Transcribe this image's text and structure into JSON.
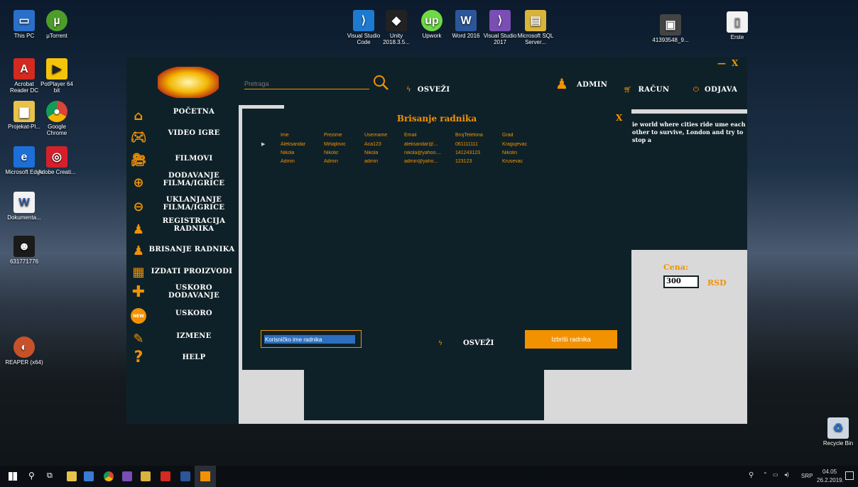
{
  "desktop": {
    "icons": [
      {
        "label": "This PC"
      },
      {
        "label": "µTorrent"
      },
      {
        "label": "Acrobat Reader DC"
      },
      {
        "label": "PotPlayer 64 bit"
      },
      {
        "label": "Projekat-Pl..."
      },
      {
        "label": "Google Chrome"
      },
      {
        "label": "Microsoft Edge"
      },
      {
        "label": "Adobe Creati..."
      },
      {
        "label": "Dokumenta..."
      },
      {
        "label": "631771776"
      },
      {
        "label": "REAPER (x64)"
      },
      {
        "label": "Visual Studio Code"
      },
      {
        "label": "Unity 2018.3.5..."
      },
      {
        "label": "Upwork"
      },
      {
        "label": "Word 2016"
      },
      {
        "label": "Visual Studio 2017"
      },
      {
        "label": "Microsoft SQL Server..."
      },
      {
        "label": "41393548_9..."
      },
      {
        "label": "Erste"
      },
      {
        "label": "Recycle Bin"
      }
    ]
  },
  "app": {
    "header": {
      "search_placeholder": "Pretraga",
      "refresh_label": "OSVEŽI",
      "admin_label": "ADMIN",
      "account_label": "RAČUN",
      "logout_label": "ODJAVA",
      "minimize_label": "—",
      "close_label": "X"
    },
    "sidebar": {
      "items": [
        {
          "label": "POČETNA"
        },
        {
          "label": "VIDEO IGRE"
        },
        {
          "label": "FILMOVI"
        },
        {
          "label": "DODAVANJE FILMA/IGRICE"
        },
        {
          "label": "UKLANJANJE FILMA/IGRICE"
        },
        {
          "label": "REGISTRACIJA RADNIKA"
        },
        {
          "label": "BRISANJE RADNIKA"
        },
        {
          "label": "IZDATI PROIZVODI"
        },
        {
          "label": "USKORO DODAVANJE"
        },
        {
          "label": "USKORO"
        },
        {
          "label": "IZMENE"
        },
        {
          "label": "HELP"
        }
      ]
    },
    "background_panel": {
      "description": "ie world where cities ride ume each other to survive, London and try to stop a",
      "price_label": "Cena:",
      "price_value": "300",
      "currency": "RSD"
    },
    "modal": {
      "title": "Brisanje radnika",
      "close_label": "X",
      "columns": [
        "Ime",
        "Prezime",
        "Username",
        "Email",
        "BrojTelefona",
        "Grad"
      ],
      "rows": [
        [
          "Aleksandar",
          "Mihajlovic",
          "Aca123",
          "aleksandar@...",
          "061111111",
          "Kragujevac"
        ],
        [
          "Nikola",
          "Nikolic",
          "Nikola",
          "nikola@yahoo....",
          "141243123",
          "Nikolin"
        ],
        [
          "Admin",
          "Admin",
          "admin",
          "admin@yaho...",
          "123123",
          "Krusevac"
        ]
      ],
      "username_input_value": "Korisničko ime radnika",
      "refresh_label": "OSVEŽI",
      "delete_button_label": "Izbriši radnika"
    }
  },
  "taskbar": {
    "language": "SRP",
    "time": "04.05",
    "date": "26.2.2019."
  },
  "colors": {
    "accent": "#f39200",
    "app_dark": "#0f2128",
    "app_light": "#d9d9d9"
  }
}
